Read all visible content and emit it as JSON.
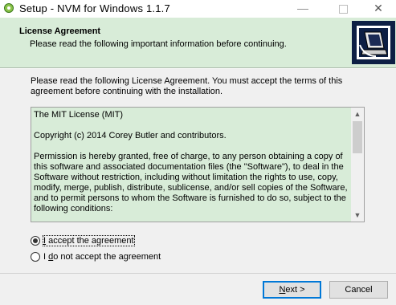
{
  "window": {
    "title": "Setup - NVM for Windows 1.1.7",
    "minimize": "—",
    "close": "✕"
  },
  "header": {
    "title": "License Agreement",
    "subtitle": "Please read the following important information before continuing."
  },
  "intro": "Please read the following License Agreement. You must accept the terms of this agreement before continuing with the installation.",
  "license": {
    "paragraphs": [
      "The MIT License (MIT)",
      "Copyright (c) 2014 Corey Butler and contributors.",
      "Permission is hereby granted, free of charge, to any person obtaining a copy of this software and associated documentation files (the \"Software\"), to deal in the Software without restriction, including without limitation the rights to use, copy, modify, merge, publish, distribute, sublicense, and/or sell copies of the Software, and to permit persons to whom the Software is furnished to do so, subject to the following conditions:"
    ],
    "scroll_up": "▲",
    "scroll_down": "▼"
  },
  "options": {
    "accept": {
      "accel": "I",
      "rest": " accept the agreement",
      "selected": true
    },
    "decline": {
      "prefix": "I ",
      "accel": "d",
      "rest": "o not accept the agreement",
      "selected": false
    }
  },
  "buttons": {
    "next": {
      "accel": "N",
      "rest": "ext >"
    },
    "cancel": "Cancel"
  },
  "colors": {
    "header_bg": "#d8ecd8",
    "memo_bg": "#d8ecd8",
    "focus_border": "#0078d7"
  }
}
